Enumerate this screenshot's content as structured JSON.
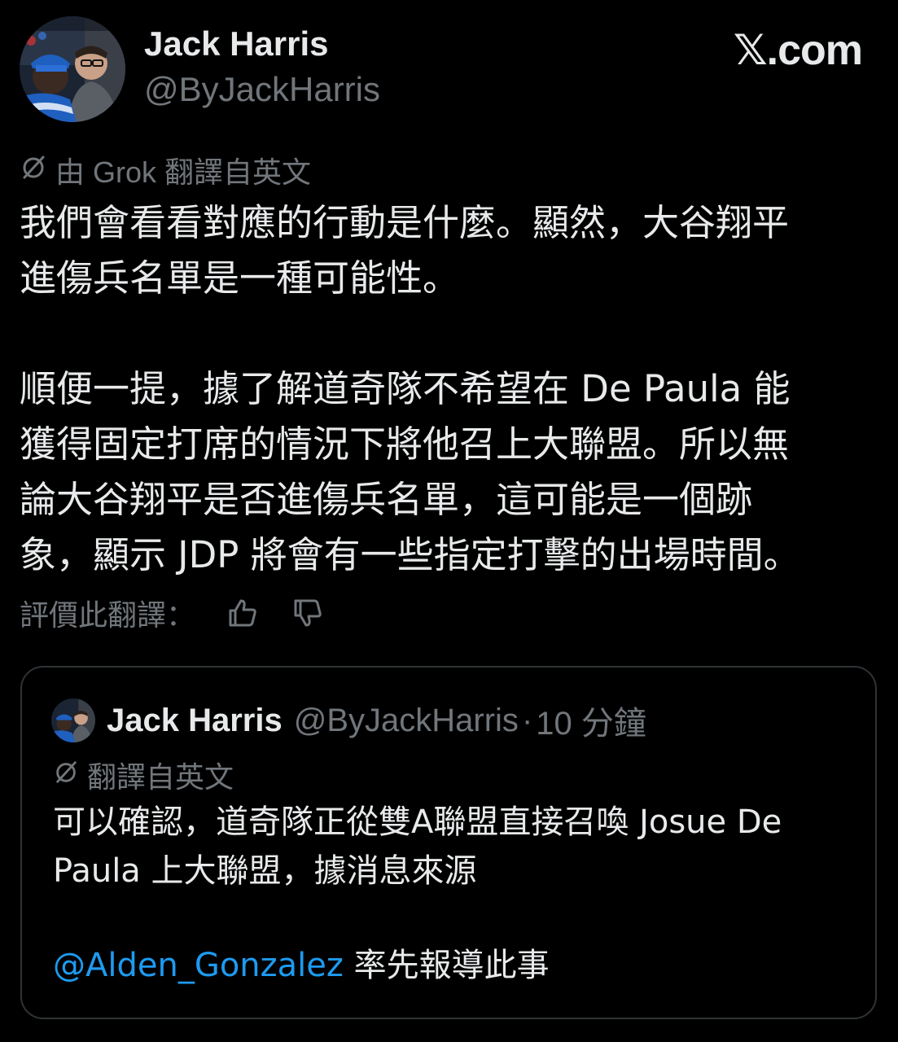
{
  "colors": {
    "background": "#000000",
    "text_primary": "#e7e9ea",
    "text_secondary": "#71767b",
    "link": "#1d9bf0",
    "border": "#2f3336"
  },
  "post": {
    "author_name": "Jack Harris",
    "author_handle": "@ByJackHarris",
    "site_logo": "𝕏.com",
    "avatar_icon": "profile-photo",
    "translation_note": "由 Grok 翻譯自英文",
    "translation_icon": "translate-slash-icon",
    "body": "我們會看看對應的行動是什麼。顯然，大谷翔平\n進傷兵名單是一種可能性。\n\n順便一提，據了解道奇隊不希望在 De Paula 能\n獲得固定打席的情況下將他召上大聯盟。所以無\n論大谷翔平是否進傷兵名單，這可能是一個跡\n象，顯示 JDP 將會有一些指定打擊的出場時間。",
    "rate_label": "評價此翻譯：",
    "thumbs_up_icon": "thumbs-up-icon",
    "thumbs_down_icon": "thumbs-down-icon"
  },
  "quote": {
    "author_name": "Jack Harris",
    "author_handle": "@ByJackHarris",
    "separator": "·",
    "time": "10 分鐘",
    "translation_note": "翻譯自英文",
    "body": "可以確認，道奇隊正從雙A聯盟直接召喚 Josue De\nPaula 上大聯盟，據消息來源",
    "mention": "@Alden_Gonzalez",
    "credit_rest": " 率先報導此事"
  }
}
